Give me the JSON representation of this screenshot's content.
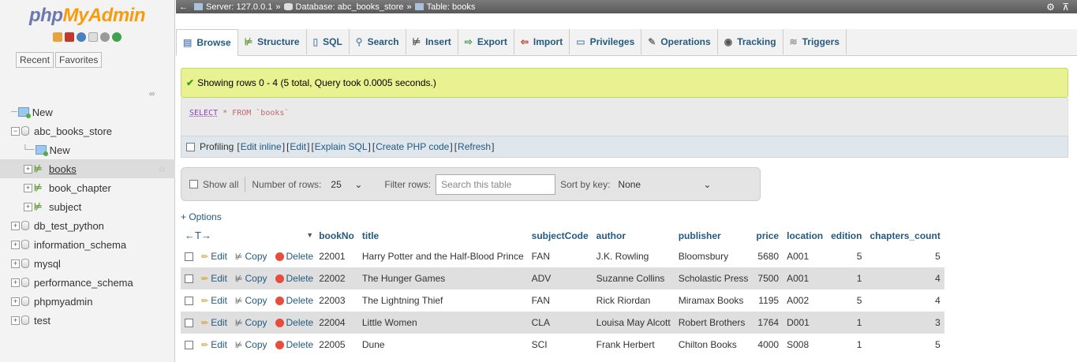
{
  "logo": {
    "php": "php",
    "myadmin": "MyAdmin"
  },
  "nav": {
    "tabs": [
      "Recent",
      "Favorites"
    ],
    "tree": [
      {
        "label": "New",
        "level": 0,
        "kind": "new"
      },
      {
        "label": "abc_books_store",
        "level": 0,
        "kind": "db"
      },
      {
        "label": "New",
        "level": 1,
        "kind": "new"
      },
      {
        "label": "books",
        "level": 1,
        "kind": "table"
      },
      {
        "label": "book_chapter",
        "level": 1,
        "kind": "table"
      },
      {
        "label": "subject",
        "level": 1,
        "kind": "table"
      },
      {
        "label": "db_test_python",
        "level": 0,
        "kind": "db"
      },
      {
        "label": "information_schema",
        "level": 0,
        "kind": "db"
      },
      {
        "label": "mysql",
        "level": 0,
        "kind": "db"
      },
      {
        "label": "performance_schema",
        "level": 0,
        "kind": "db"
      },
      {
        "label": "phpmyadmin",
        "level": 0,
        "kind": "db"
      },
      {
        "label": "test",
        "level": 0,
        "kind": "db"
      }
    ]
  },
  "breadcrumb": {
    "server": "Server: 127.0.0.1",
    "database": "Database: abc_books_store",
    "table": "Table: books"
  },
  "menu": {
    "tabs": [
      "Browse",
      "Structure",
      "SQL",
      "Search",
      "Insert",
      "Export",
      "Import",
      "Privileges",
      "Operations",
      "Tracking",
      "Triggers"
    ]
  },
  "result": {
    "success_message": "Showing rows 0 - 4 (5 total, Query took 0.0005 seconds.)",
    "sql_keyword": "SELECT",
    "sql_rest": " * FROM `books`"
  },
  "profiling": {
    "label": "Profiling",
    "links": [
      "Edit inline",
      "Edit",
      "Explain SQL",
      "Create PHP code",
      "Refresh"
    ]
  },
  "filter": {
    "show_all": "Show all",
    "number_of_rows_label": "Number of rows:",
    "number_of_rows_value": "25",
    "filter_rows_label": "Filter rows:",
    "search_placeholder": "Search this table",
    "sort_by_key_label": "Sort by key:",
    "sort_by_key_value": "None"
  },
  "options_link": "+ Options",
  "table": {
    "nav_arrows": "←T→",
    "sort_indicator": "▼",
    "columns": [
      "bookNo",
      "title",
      "subjectCode",
      "author",
      "publisher",
      "price",
      "location",
      "edition",
      "chapters_count"
    ],
    "actions": {
      "edit": "Edit",
      "copy": "Copy",
      "delete": "Delete"
    },
    "rows": [
      [
        "22001",
        "Harry Potter and the Half-Blood Prince",
        "FAN",
        "J.K. Rowling",
        "Bloomsbury",
        "5680",
        "A001",
        "5",
        "5"
      ],
      [
        "22002",
        "The Hunger Games",
        "ADV",
        "Suzanne Collins",
        "Scholastic Press",
        "7500",
        "A001",
        "1",
        "4"
      ],
      [
        "22003",
        "The Lightning Thief",
        "FAN",
        "Rick Riordan",
        "Miramax Books",
        "1195",
        "A002",
        "5",
        "4"
      ],
      [
        "22004",
        "Little Women",
        "CLA",
        "Louisa May Alcott",
        "Robert Brothers",
        "1764",
        "D001",
        "1",
        "3"
      ],
      [
        "22005",
        "Dune",
        "SCI",
        "Frank Herbert",
        "Chilton Books",
        "4000",
        "S008",
        "1",
        "5"
      ]
    ]
  }
}
